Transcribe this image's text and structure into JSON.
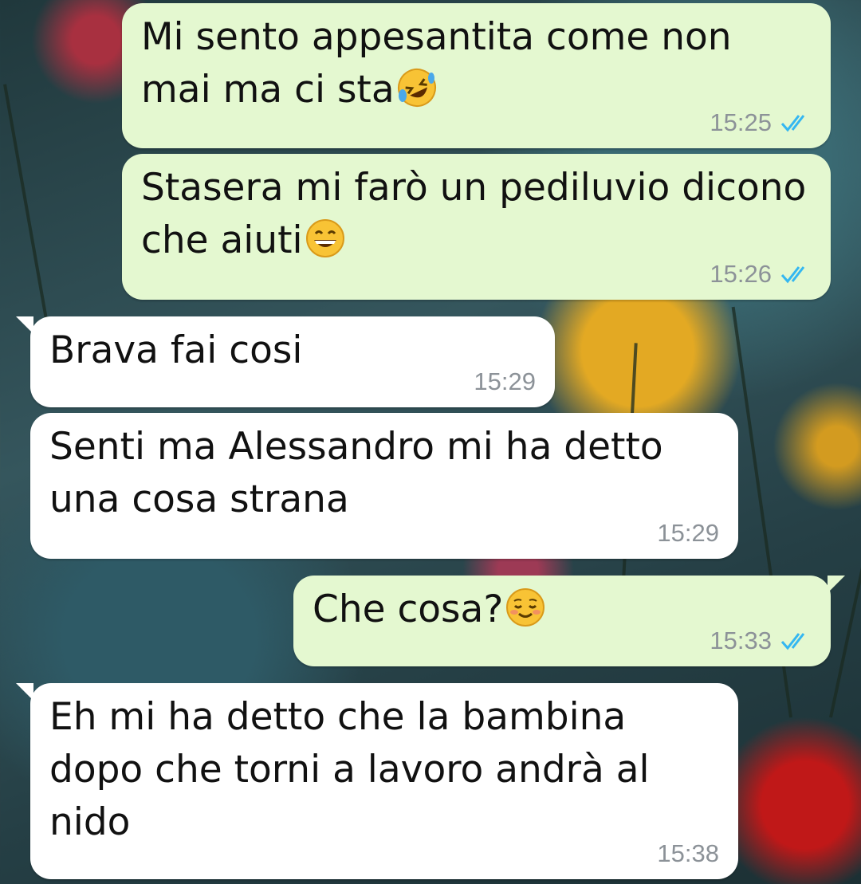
{
  "messages": [
    {
      "direction": "out",
      "text": "Mi sento appesantita come non mai ma ci sta",
      "emoji": "rolling-on-floor-laughing",
      "time": "15:25",
      "read": true
    },
    {
      "direction": "out",
      "text": "Stasera mi farò un pediluvio dicono che aiuti",
      "emoji": "grinning-face",
      "time": "15:26",
      "read": true
    },
    {
      "direction": "in",
      "text": "Brava fai cosi",
      "time": "15:29"
    },
    {
      "direction": "in",
      "text": "Senti ma Alessandro mi ha detto una cosa strana",
      "time": "15:29"
    },
    {
      "direction": "out",
      "text": "Che cosa?",
      "emoji": "smiling-face",
      "time": "15:33",
      "read": true
    },
    {
      "direction": "in",
      "text": "Eh mi ha detto che la bambina dopo che torni a lavoro andrà al nido",
      "time": "15:38"
    }
  ],
  "colors": {
    "outgoing_bubble": "#e4f8d0",
    "incoming_bubble": "#ffffff",
    "read_ticks": "#34b7f1",
    "timestamp": "#8c9298"
  },
  "icons": {
    "read_receipt": "double-check-icon"
  }
}
